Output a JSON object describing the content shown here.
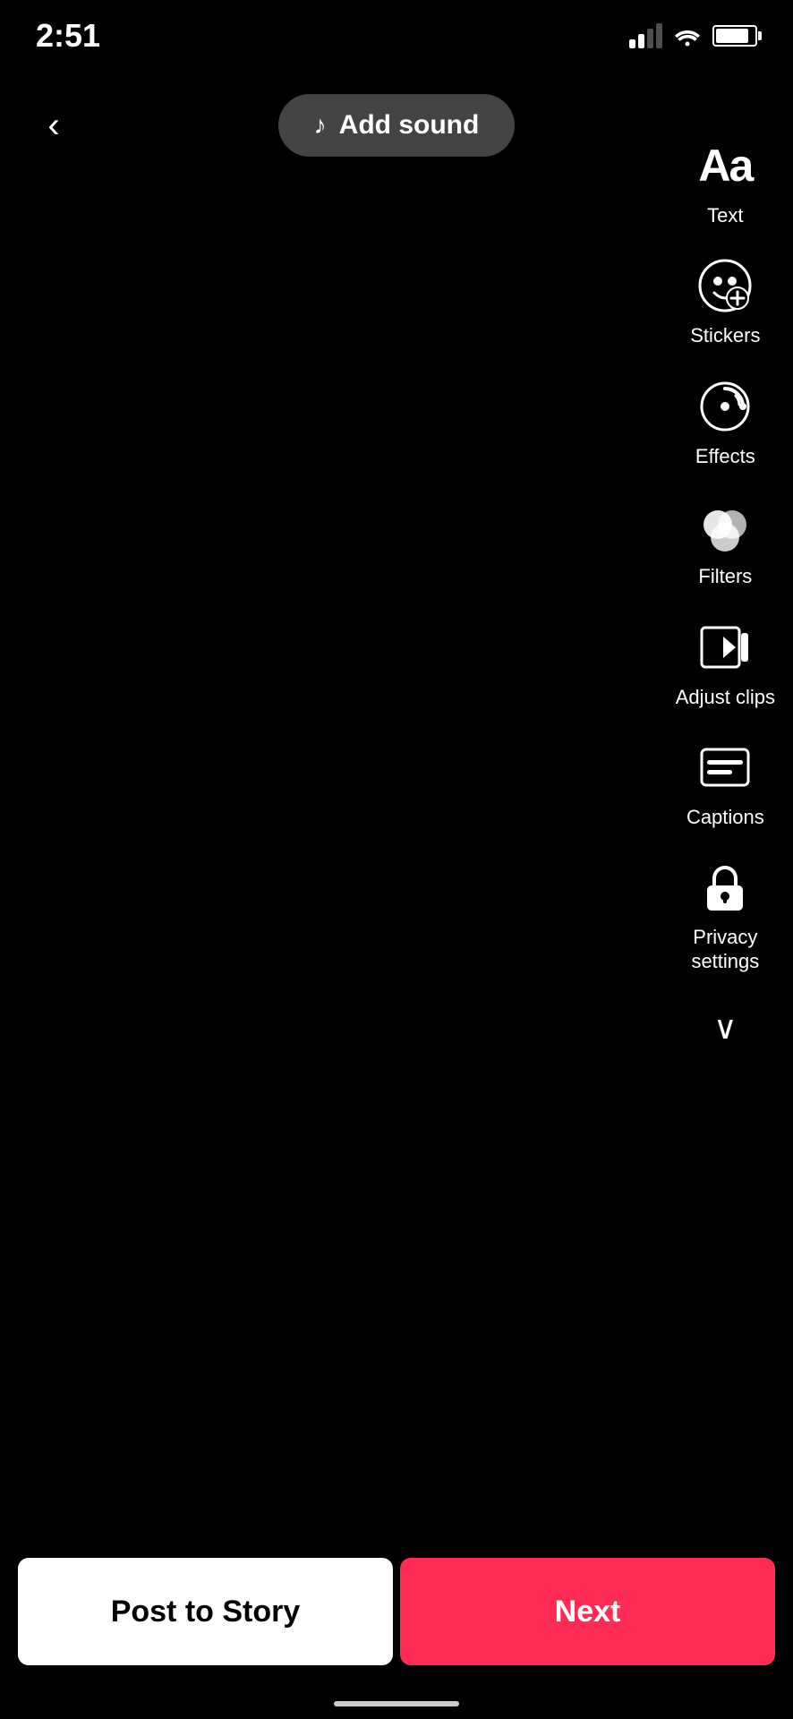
{
  "statusBar": {
    "time": "2:51"
  },
  "header": {
    "backLabel": "‹",
    "addSoundLabel": "Add sound"
  },
  "tools": [
    {
      "id": "text",
      "label": "Text",
      "iconType": "text-aa"
    },
    {
      "id": "stickers",
      "label": "Stickers",
      "iconType": "sticker"
    },
    {
      "id": "effects",
      "label": "Effects",
      "iconType": "effects"
    },
    {
      "id": "filters",
      "label": "Filters",
      "iconType": "filters"
    },
    {
      "id": "adjust-clips",
      "label": "Adjust clips",
      "iconType": "adjust"
    },
    {
      "id": "captions",
      "label": "Captions",
      "iconType": "captions"
    },
    {
      "id": "privacy-settings",
      "label": "Privacy\nsettings",
      "iconType": "privacy"
    }
  ],
  "bottomButtons": {
    "postToStory": "Post to Story",
    "next": "Next"
  }
}
